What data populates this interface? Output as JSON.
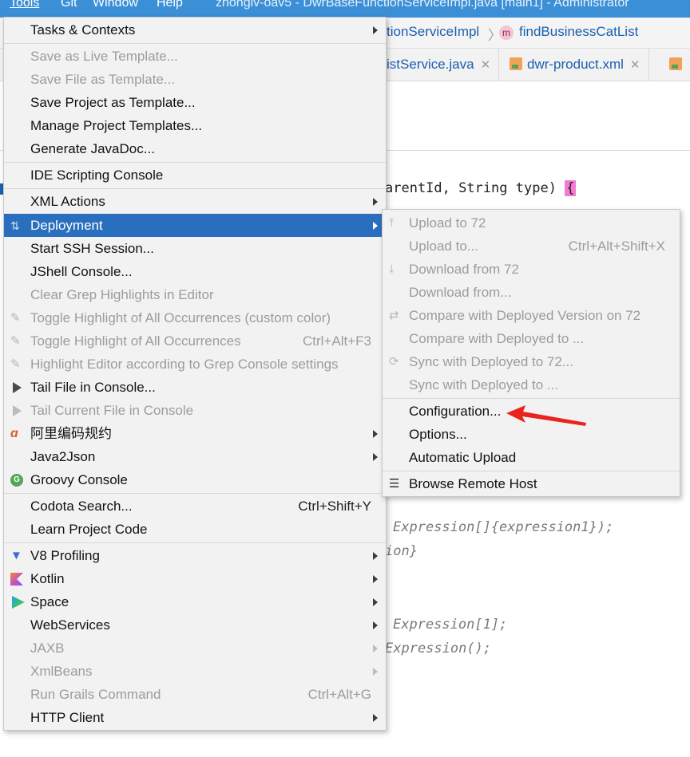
{
  "menubar": {
    "items": [
      "Tools",
      "Git",
      "Window",
      "Help"
    ],
    "title": "zhongiv-oav5 - DwrBaseFunctionServiceImpl.java [main1] - Administrator"
  },
  "breadcrumb": {
    "class_name": "tionServiceImpl",
    "method_badge": "m",
    "method_name": "findBusinessCatList"
  },
  "tabs": [
    {
      "label": "istService.java"
    },
    {
      "label": "dwr-product.xml"
    }
  ],
  "code": {
    "line1": "arentId, String type) ",
    "line1_brace": "{",
    "line2": "Expression[]{expression1});",
    "line3": "ion}",
    "line4": "Expression[1];",
    "line5": "Expression();"
  },
  "tools_menu": {
    "items": [
      {
        "label": "Tasks & Contexts",
        "submenu": true
      },
      {
        "label": "Save as Live Template...",
        "disabled": true
      },
      {
        "label": "Save File as Template...",
        "disabled": true
      },
      {
        "label": "Save Project as Template..."
      },
      {
        "label": "Manage Project Templates..."
      },
      {
        "label": "Generate JavaDoc..."
      },
      {
        "label": "IDE Scripting Console"
      },
      {
        "label": "XML Actions",
        "submenu": true
      },
      {
        "label": "Deployment",
        "submenu": true,
        "selected": true
      },
      {
        "label": "Start SSH Session..."
      },
      {
        "label": "JShell Console..."
      },
      {
        "label": "Clear Grep Highlights in Editor",
        "disabled": true
      },
      {
        "label": "Toggle Highlight of All Occurrences (custom color)",
        "disabled": true
      },
      {
        "label": "Toggle Highlight of All Occurrences",
        "shortcut": "Ctrl+Alt+F3",
        "disabled": true
      },
      {
        "label": "Highlight Editor according to Grep Console settings",
        "disabled": true
      },
      {
        "label": "Tail File in Console..."
      },
      {
        "label": "Tail Current File in Console",
        "disabled": true
      },
      {
        "label": "阿里编码规约",
        "submenu": true
      },
      {
        "label": "Java2Json",
        "submenu": true
      },
      {
        "label": "Groovy Console"
      },
      {
        "label": "Codota Search...",
        "shortcut": "Ctrl+Shift+Y"
      },
      {
        "label": "Learn Project Code"
      },
      {
        "label": "V8 Profiling",
        "submenu": true
      },
      {
        "label": "Kotlin",
        "submenu": true
      },
      {
        "label": "Space",
        "submenu": true
      },
      {
        "label": "WebServices",
        "submenu": true
      },
      {
        "label": "JAXB",
        "submenu": true,
        "disabled": true
      },
      {
        "label": "XmlBeans",
        "submenu": true,
        "disabled": true
      },
      {
        "label": "Run Grails Command",
        "shortcut": "Ctrl+Alt+G",
        "disabled": true
      },
      {
        "label": "HTTP Client",
        "submenu": true
      }
    ]
  },
  "deployment_menu": {
    "items": [
      {
        "label": "Upload to 72",
        "disabled": true
      },
      {
        "label": "Upload to...",
        "shortcut": "Ctrl+Alt+Shift+X",
        "disabled": true
      },
      {
        "label": "Download from 72",
        "disabled": true
      },
      {
        "label": "Download from...",
        "disabled": true
      },
      {
        "label": "Compare with Deployed Version on 72",
        "disabled": true
      },
      {
        "label": "Compare with Deployed to ...",
        "disabled": true
      },
      {
        "label": "Sync with Deployed to 72...",
        "disabled": true
      },
      {
        "label": "Sync with Deployed to ...",
        "disabled": true
      },
      {
        "label": "Configuration..."
      },
      {
        "label": "Options..."
      },
      {
        "label": "Automatic Upload"
      },
      {
        "label": "Browse Remote Host"
      }
    ]
  },
  "colors": {
    "menubar": "#3b8fd6",
    "selection": "#2a6fbe",
    "annotation_arrow": "#e8241c"
  }
}
